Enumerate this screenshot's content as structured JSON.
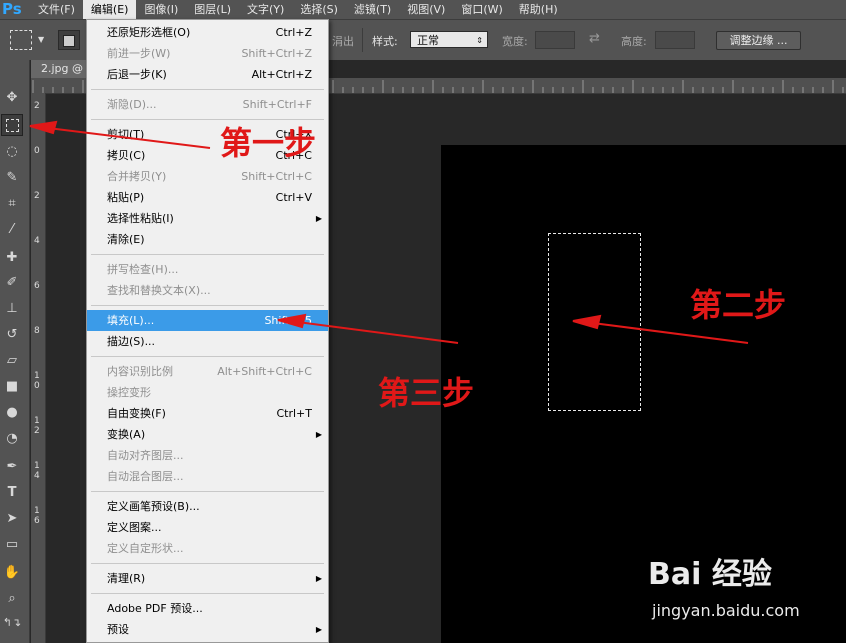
{
  "app": {
    "logo": "Ps"
  },
  "menubar": {
    "items": [
      "文件(F)",
      "编辑(E)",
      "图像(I)",
      "图层(L)",
      "文字(Y)",
      "选择(S)",
      "滤镜(T)",
      "视图(V)",
      "窗口(W)",
      "帮助(H)"
    ],
    "active_index": 1
  },
  "options": {
    "partial_label": "涓出",
    "style_label": "样式:",
    "style_value": "正常",
    "width_label": "宽度:",
    "height_label": "高度:",
    "refine_button": "调整边缘 ..."
  },
  "document": {
    "tab_label": "2.jpg @"
  },
  "rulers": {
    "left_ticks": [
      "2",
      "0",
      "2",
      "4",
      "6",
      "8",
      "1\n0",
      "1\n2",
      "1\n4",
      "1\n6"
    ]
  },
  "edit_menu": {
    "items": [
      {
        "label": "还原矩形选框(O)",
        "shortcut": "Ctrl+Z",
        "enabled": true
      },
      {
        "label": "前进一步(W)",
        "shortcut": "Shift+Ctrl+Z",
        "enabled": false
      },
      {
        "label": "后退一步(K)",
        "shortcut": "Alt+Ctrl+Z",
        "enabled": true
      },
      {
        "sep": true
      },
      {
        "label": "渐隐(D)...",
        "shortcut": "Shift+Ctrl+F",
        "enabled": false
      },
      {
        "sep": true
      },
      {
        "label": "剪切(T)",
        "shortcut": "Ctrl+X",
        "enabled": true
      },
      {
        "label": "拷贝(C)",
        "shortcut": "Ctrl+C",
        "enabled": true
      },
      {
        "label": "合并拷贝(Y)",
        "shortcut": "Shift+Ctrl+C",
        "enabled": false
      },
      {
        "label": "粘贴(P)",
        "shortcut": "Ctrl+V",
        "enabled": true
      },
      {
        "label": "选择性粘贴(I)",
        "shortcut": "",
        "enabled": true,
        "submenu": true
      },
      {
        "label": "清除(E)",
        "shortcut": "",
        "enabled": true
      },
      {
        "sep": true
      },
      {
        "label": "拼写检查(H)...",
        "shortcut": "",
        "enabled": false
      },
      {
        "label": "查找和替换文本(X)...",
        "shortcut": "",
        "enabled": false
      },
      {
        "sep": true
      },
      {
        "label": "填充(L)...",
        "shortcut": "Shift+F5",
        "enabled": true,
        "highlighted": true
      },
      {
        "label": "描边(S)...",
        "shortcut": "",
        "enabled": true
      },
      {
        "sep": true
      },
      {
        "label": "内容识别比例",
        "shortcut": "Alt+Shift+Ctrl+C",
        "enabled": false
      },
      {
        "label": "操控变形",
        "shortcut": "",
        "enabled": false
      },
      {
        "label": "自由变换(F)",
        "shortcut": "Ctrl+T",
        "enabled": true
      },
      {
        "label": "变换(A)",
        "shortcut": "",
        "enabled": true,
        "submenu": true
      },
      {
        "label": "自动对齐图层...",
        "shortcut": "",
        "enabled": false
      },
      {
        "label": "自动混合图层...",
        "shortcut": "",
        "enabled": false
      },
      {
        "sep": true
      },
      {
        "label": "定义画笔预设(B)...",
        "shortcut": "",
        "enabled": true
      },
      {
        "label": "定义图案...",
        "shortcut": "",
        "enabled": true
      },
      {
        "label": "定义自定形状...",
        "shortcut": "",
        "enabled": false
      },
      {
        "sep": true
      },
      {
        "label": "清理(R)",
        "shortcut": "",
        "enabled": true,
        "submenu": true
      },
      {
        "sep": true
      },
      {
        "label": "Adobe PDF 预设...",
        "shortcut": "",
        "enabled": true
      },
      {
        "label": "预设",
        "shortcut": "",
        "enabled": true,
        "submenu": true
      }
    ]
  },
  "annotations": {
    "step1": "第一步",
    "step2": "第二步",
    "step3": "第三步",
    "color": "#e01818"
  },
  "watermark": {
    "brand": "Bai 经验",
    "url": "jingyan.baidu.com"
  }
}
